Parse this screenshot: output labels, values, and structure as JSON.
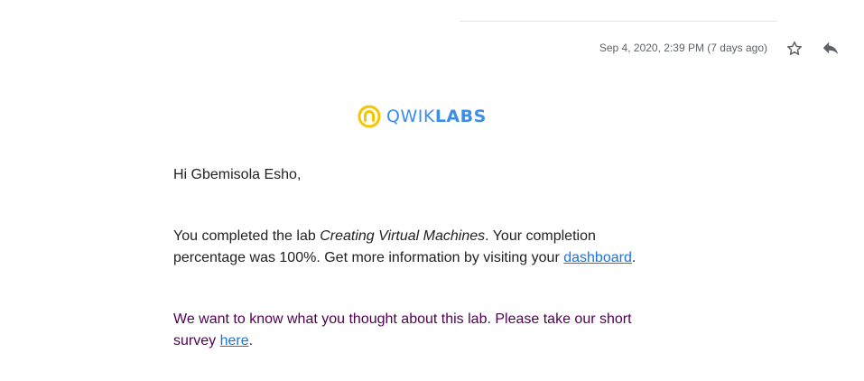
{
  "header": {
    "timestamp": "Sep 4, 2020, 2:39 PM (7 days ago)",
    "star_icon": "star-outline-icon",
    "reply_icon": "reply-icon"
  },
  "brand": {
    "logo_text_light": "QWIK",
    "logo_text_bold": "LABS",
    "mark_color_yellow": "#f7c400",
    "text_color": "#3c8ee8"
  },
  "email": {
    "greeting": "Hi Gbemisola Esho,",
    "completion": {
      "before_lab": "You completed the lab ",
      "lab_name": "Creating Virtual Machines",
      "after_lab": ". Your completion percentage was 100%. Get more information by visiting your ",
      "dashboard_link": "dashboard",
      "end": "."
    },
    "survey": {
      "before_link": "We want to know what you thought about this lab. Please take our short survey ",
      "link": "here",
      "end": "."
    }
  },
  "colors": {
    "link": "#1a73e8",
    "survey_text": "#500050",
    "meta_text": "#5f6368"
  }
}
